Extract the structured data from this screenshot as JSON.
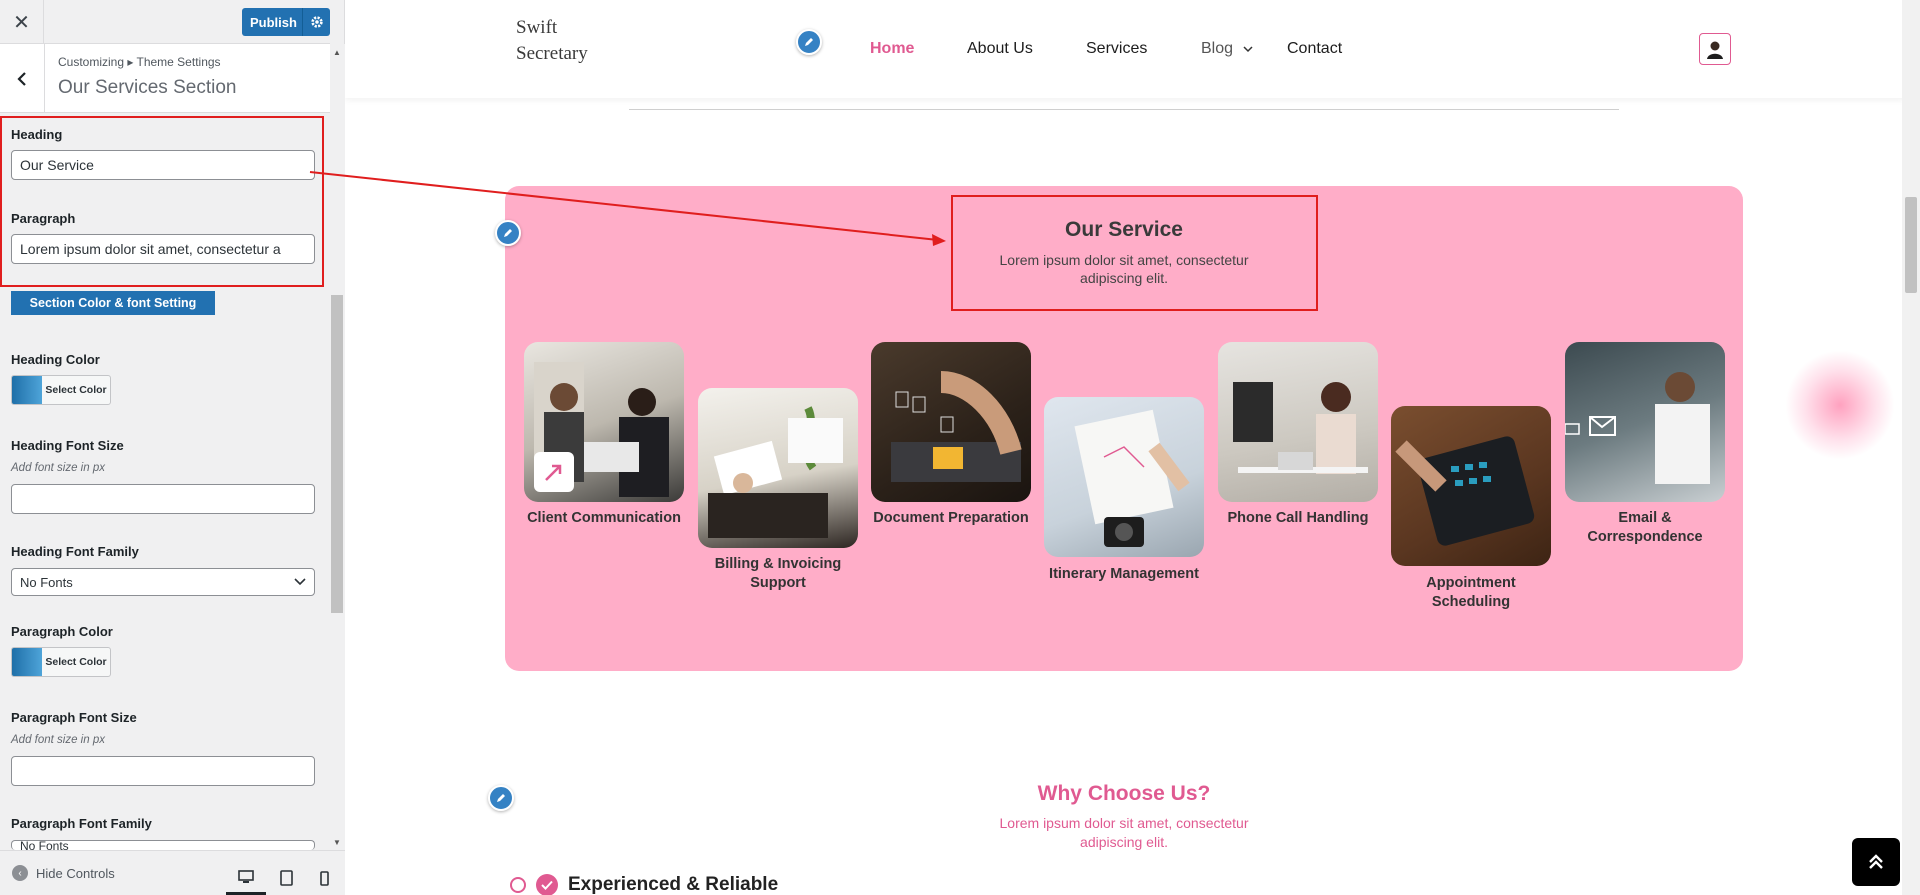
{
  "customizer": {
    "close_icon": "close-icon",
    "publish_label": "Publish",
    "breadcrumb": "Customizing ▸ Theme Settings",
    "section_title": "Our Services Section",
    "heading_label": "Heading",
    "heading_value": "Our Service",
    "paragraph_label": "Paragraph",
    "paragraph_value": "Lorem ipsum dolor sit amet, consectetur a",
    "section_setting_label": "Section Color & font Setting",
    "heading_color_label": "Heading Color",
    "select_color_label": "Select Color",
    "heading_font_size_label": "Heading Font Size",
    "font_size_desc": "Add font size in px",
    "heading_font_family_label": "Heading Font Family",
    "no_fonts": "No Fonts",
    "paragraph_color_label": "Paragraph Color",
    "paragraph_font_size_label": "Paragraph Font Size",
    "paragraph_font_family_label": "Paragraph Font Family",
    "hide_controls": "Hide Controls",
    "colors": {
      "accent": "#2271b1",
      "highlight": "#e01e1e"
    }
  },
  "site": {
    "logo_line1": "Swift",
    "logo_line2": "Secretary",
    "nav": {
      "home": "Home",
      "about": "About Us",
      "services": "Services",
      "blog": "Blog",
      "contact": "Contact"
    },
    "services": {
      "heading": "Our Service",
      "paragraph": "Lorem ipsum dolor sit amet, consectetur adipiscing elit.",
      "items": [
        {
          "label": "Client Communication"
        },
        {
          "label": "Billing & Invoicing Support"
        },
        {
          "label": "Document Preparation"
        },
        {
          "label": "Itinerary Management"
        },
        {
          "label": "Phone Call Handling"
        },
        {
          "label": "Appointment Scheduling"
        },
        {
          "label": "Email & Correspondence"
        }
      ]
    },
    "why": {
      "title": "Why Choose Us?",
      "paragraph": "Lorem ipsum dolor sit amet, consectetur adipiscing elit.",
      "first_item": "Experienced & Reliable"
    },
    "colors": {
      "brand_pink": "#e05a91",
      "card_pink": "#ffadc8"
    }
  }
}
